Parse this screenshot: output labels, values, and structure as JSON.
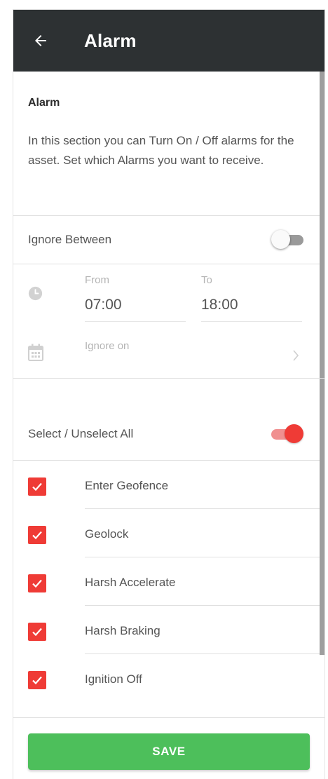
{
  "appbar": {
    "title": "Alarm",
    "back_icon": "arrow-left-icon"
  },
  "intro": {
    "heading": "Alarm",
    "description": "In this section you can Turn On / Off alarms for the asset. Set which Alarms you want to receive."
  },
  "ignore_between": {
    "label": "Ignore Between",
    "enabled": false
  },
  "time_range": {
    "from_label": "From",
    "from_value": "07:00",
    "to_label": "To",
    "to_value": "18:00",
    "ignore_on_label": "Ignore on"
  },
  "select_all": {
    "label": "Select / Unselect All",
    "enabled": true
  },
  "alarms": [
    {
      "label": "Enter Geofence",
      "checked": true
    },
    {
      "label": "Geolock",
      "checked": true
    },
    {
      "label": "Harsh Accelerate",
      "checked": true
    },
    {
      "label": "Harsh Braking",
      "checked": true
    },
    {
      "label": "Ignition Off",
      "checked": true
    }
  ],
  "footer": {
    "save_label": "SAVE"
  },
  "colors": {
    "appbar": "#2d3133",
    "accent": "#ef3b36",
    "save": "#4dbf5b"
  }
}
